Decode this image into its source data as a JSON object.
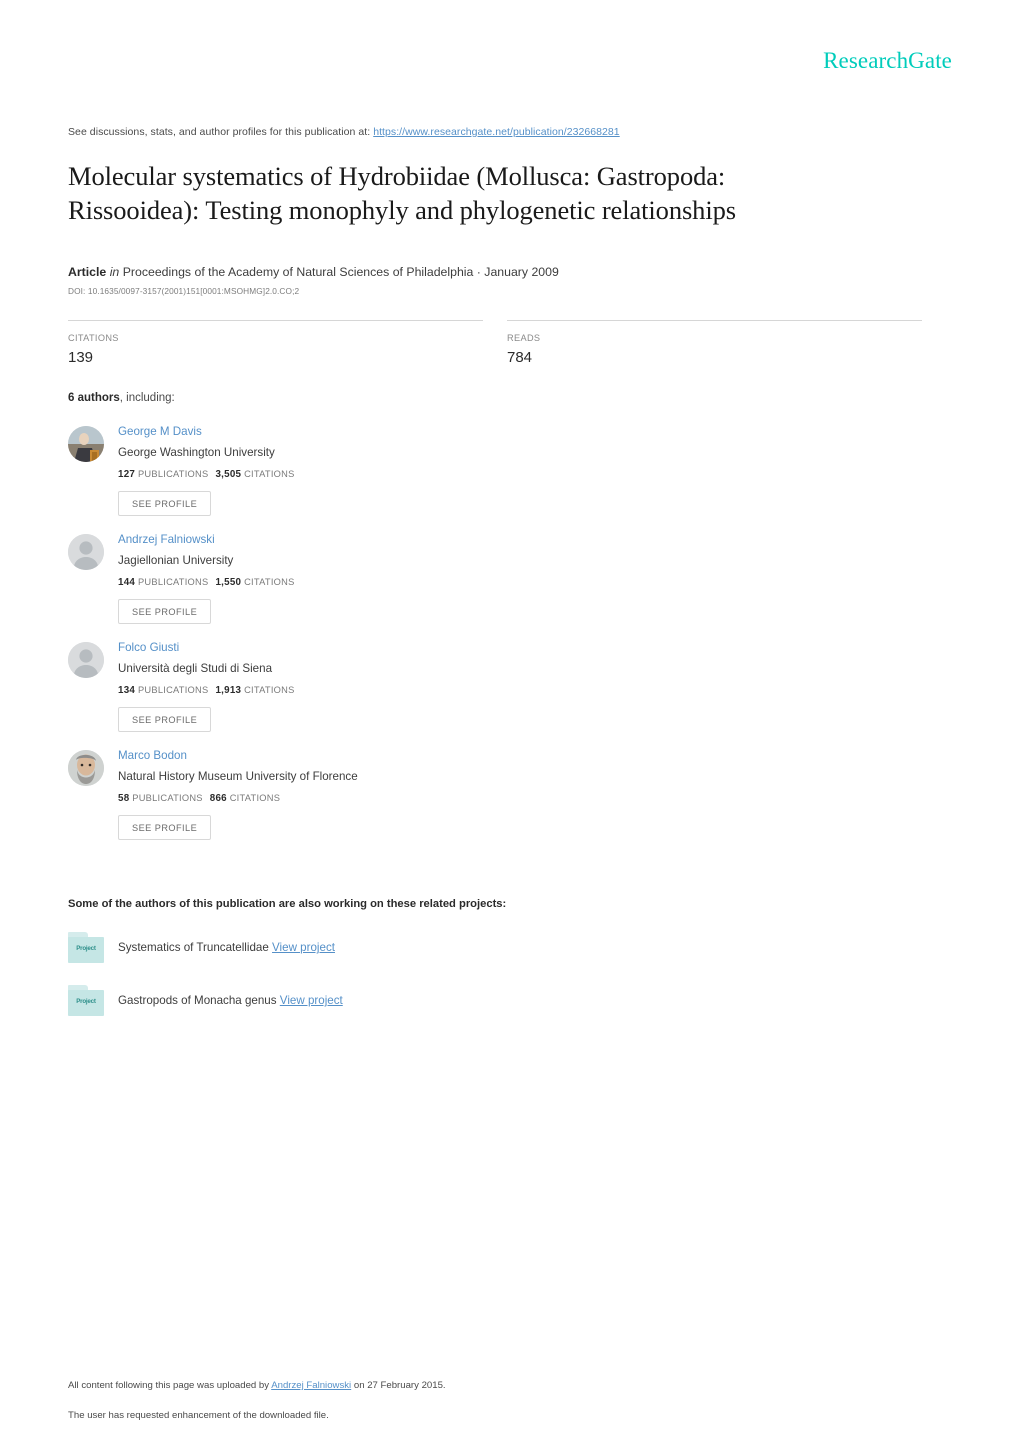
{
  "brand": {
    "logo_text": "ResearchGate",
    "accent_color": "#00ccbb"
  },
  "discussion": {
    "prefix": "See discussions, stats, and author profiles for this publication at: ",
    "url": "https://www.researchgate.net/publication/232668281"
  },
  "publication": {
    "title": "Molecular systematics of Hydrobiidae (Mollusca: Gastropoda: Rissooidea): Testing monophyly and phylogenetic relationships",
    "type_label": "Article",
    "in_label": "in",
    "venue": "Proceedings of the Academy of Natural Sciences of Philadelphia · January 2009",
    "doi": "DOI: 10.1635/0097-3157(2001)151[0001:MSOHMG]2.0.CO;2"
  },
  "stats": [
    {
      "label": "CITATIONS",
      "value": "139"
    },
    {
      "label": "READS",
      "value": "784"
    }
  ],
  "authors_heading": {
    "count_text": "6 authors",
    "rest_text": ", including:"
  },
  "authors": [
    {
      "name": "George M Davis",
      "affiliation": "George Washington University",
      "publications": "127",
      "publications_label": "PUBLICATIONS",
      "citations": "3,505",
      "citations_label": "CITATIONS",
      "button_label": "SEE PROFILE",
      "avatar_type": "photo"
    },
    {
      "name": "Andrzej Falniowski",
      "affiliation": "Jagiellonian University",
      "publications": "144",
      "publications_label": "PUBLICATIONS",
      "citations": "1,550",
      "citations_label": "CITATIONS",
      "button_label": "SEE PROFILE",
      "avatar_type": "placeholder"
    },
    {
      "name": "Folco Giusti",
      "affiliation": "Università degli Studi di Siena",
      "publications": "134",
      "publications_label": "PUBLICATIONS",
      "citations": "1,913",
      "citations_label": "CITATIONS",
      "button_label": "SEE PROFILE",
      "avatar_type": "placeholder"
    },
    {
      "name": "Marco Bodon",
      "affiliation": "Natural History Museum University of Florence",
      "publications": "58",
      "publications_label": "PUBLICATIONS",
      "citations": "866",
      "citations_label": "CITATIONS",
      "button_label": "SEE PROFILE",
      "avatar_type": "photo"
    }
  ],
  "projects_section": {
    "heading": "Some of the authors of this publication are also working on these related projects:",
    "icon_label": "Project",
    "view_label": "View project",
    "items": [
      {
        "title": "Systematics of Truncatellidae"
      },
      {
        "title": "Gastropods of Monacha genus"
      }
    ]
  },
  "footer": {
    "line1_prefix": "All content following this page was uploaded by ",
    "line1_link": "Andrzej Falniowski",
    "line1_suffix": " on 27 February 2015.",
    "line2": "The user has requested enhancement of the downloaded file."
  }
}
